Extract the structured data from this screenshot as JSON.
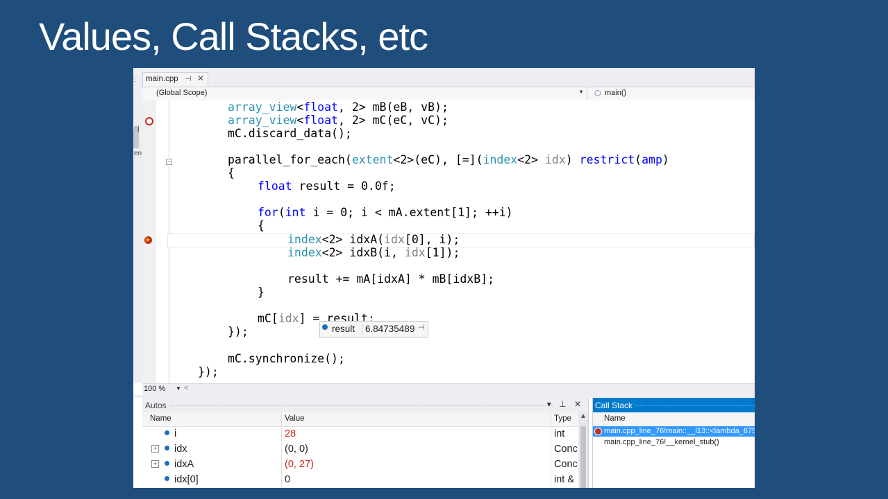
{
  "slide": {
    "title": "Values, Call Stacks, etc"
  },
  "left_strip": {
    "labels": [
      ":",
      "oj",
      "en"
    ]
  },
  "editor_tab": {
    "label": "main.cpp",
    "pin": "⊣",
    "close": "✕"
  },
  "nav_bar": {
    "scope": "(Global Scope)",
    "member": "main()"
  },
  "zoom": {
    "level": "100 %"
  },
  "datatip": {
    "name": "result",
    "value": "6.84735489"
  },
  "autos": {
    "title": "Autos",
    "controls": "▾ ⊥ ✕",
    "columns": {
      "name": "Name",
      "value": "Value",
      "type": "Type"
    },
    "rows": [
      {
        "name": "i",
        "value": "28",
        "type": "int"
      },
      {
        "name": "idx",
        "value": "(0, 0)",
        "type": "Conc"
      },
      {
        "name": "idxA",
        "value": "(0, 27)",
        "type": "Conc"
      },
      {
        "name": "idx[0]",
        "value": "0",
        "type": "int &"
      }
    ]
  },
  "call_stack": {
    "title": "Call Stack",
    "column": "Name",
    "frames": [
      {
        "text": "main.cpp_line_76!main::__l13::<lambda_675"
      },
      {
        "text": "main.cpp_line_76!__kernel_stub()"
      }
    ]
  },
  "colors": {
    "slide_bg": "#1f4e7d",
    "keyword": "#0000ff",
    "type": "#2b91af",
    "changed_value": "#c42b1c",
    "accent": "#007acc"
  }
}
